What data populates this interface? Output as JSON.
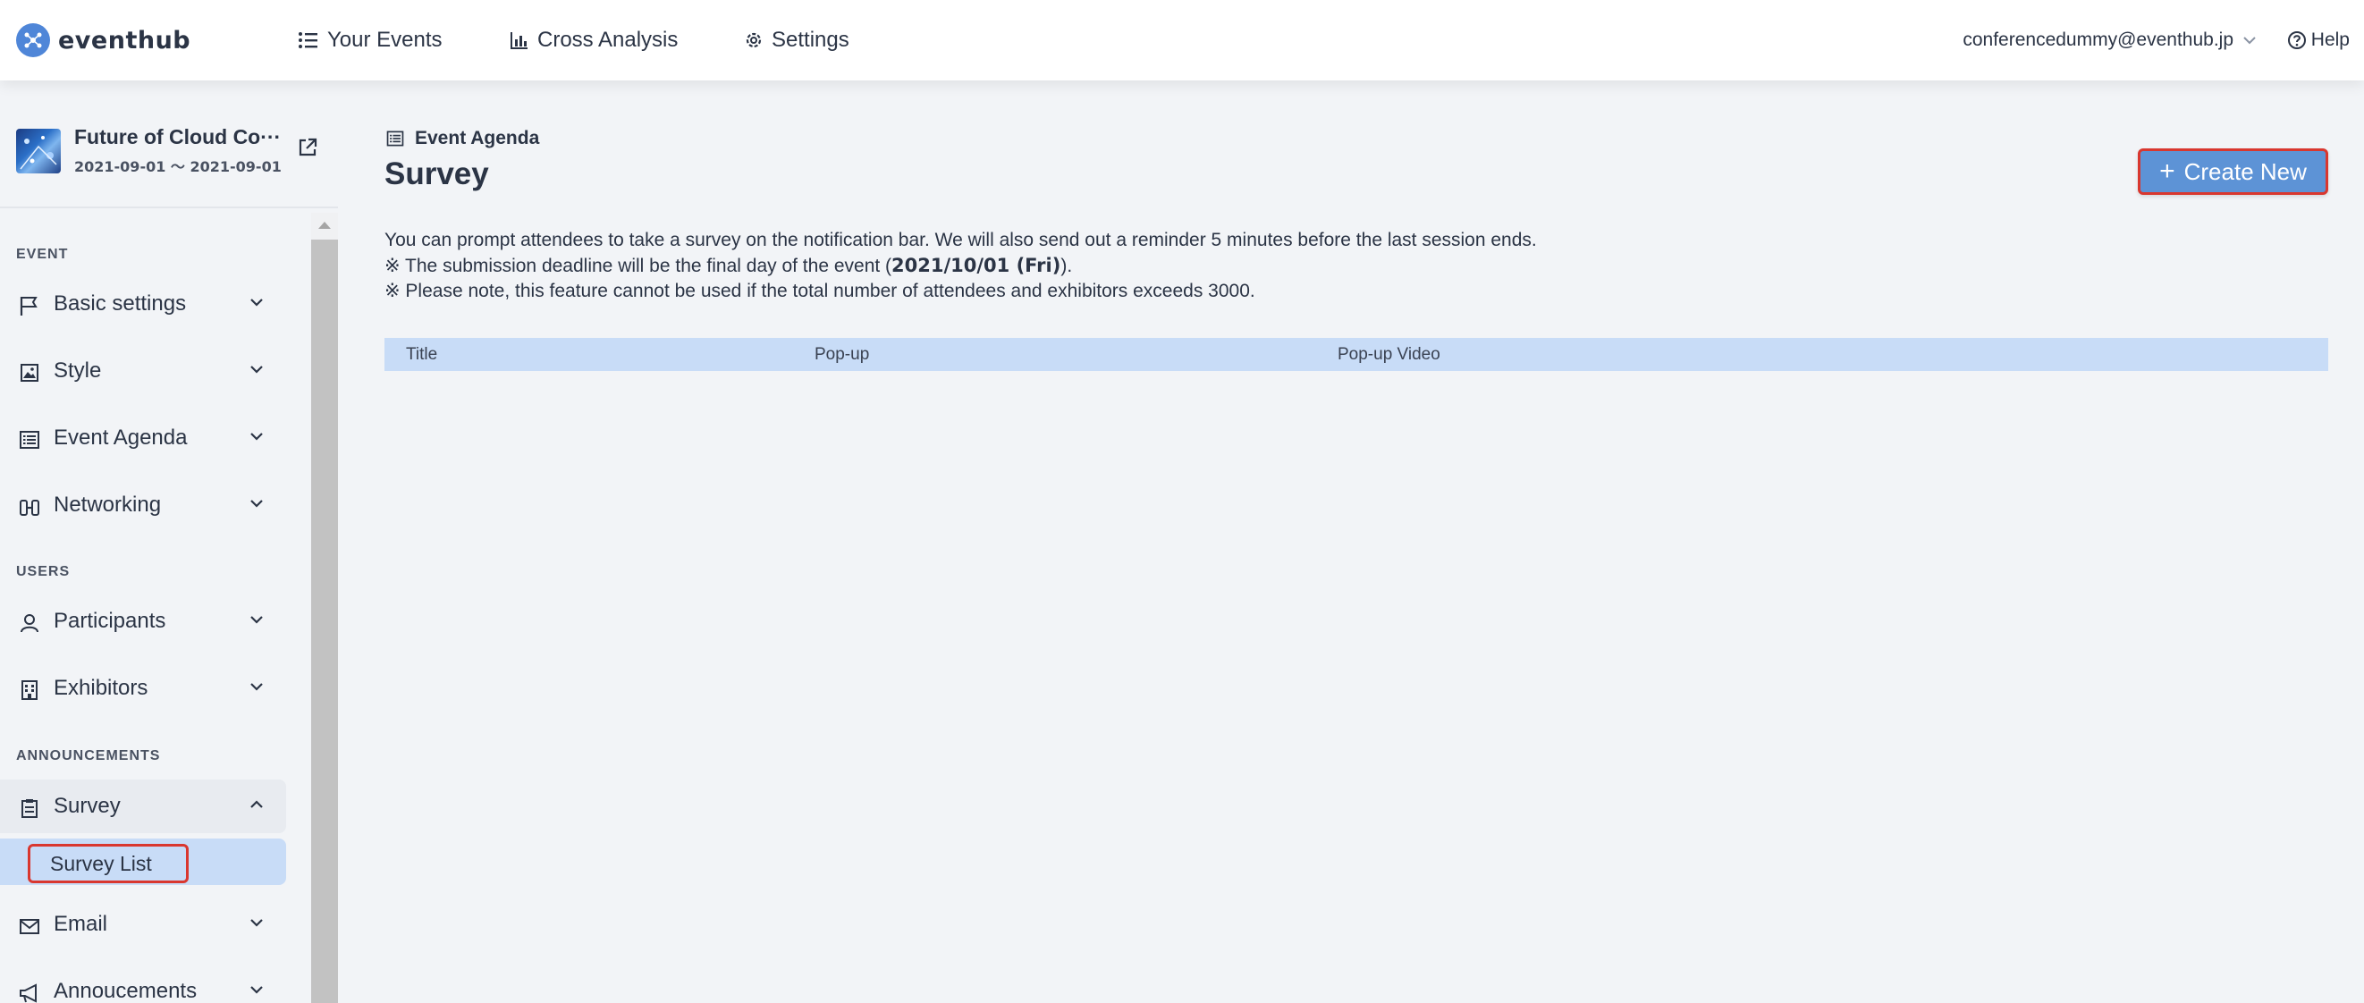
{
  "app": {
    "brand": "eventhub",
    "nav": [
      {
        "label": "Your Events",
        "icon": "list-icon"
      },
      {
        "label": "Cross Analysis",
        "icon": "bar-chart-icon"
      },
      {
        "label": "Settings",
        "icon": "gear-icon"
      }
    ],
    "account_email": "conferencedummy@eventhub.jp",
    "help_label": "Help",
    "accent_color": "#5d93d6",
    "highlight_color": "#d9372f"
  },
  "sidebar": {
    "event_title": "Future of Cloud Co···",
    "event_dates": "2021-09-01 〜 2021-09-01",
    "sections": {
      "event": "EVENT",
      "users": "USERS",
      "announcements": "ANNOUNCEMENTS"
    },
    "items": {
      "basic_settings": "Basic settings",
      "style": "Style",
      "event_agenda": "Event Agenda",
      "networking": "Networking",
      "participants": "Participants",
      "exhibitors": "Exhibitors",
      "survey": "Survey",
      "survey_list": "Survey List",
      "email": "Email",
      "announcements": "Annoucements"
    }
  },
  "main": {
    "breadcrumb": "Event Agenda",
    "title": "Survey",
    "create_button": "Create New",
    "description": {
      "line1": "You can prompt attendees to take a survey on the notification bar. We will also send out a reminder 5 minutes before the last session ends.",
      "line2_prefix": "※ The submission deadline will be the final day of the event (",
      "line2_date": "2021/10/01 (Fri)",
      "line2_suffix": ").",
      "line3": "※ Please note, this feature cannot be used if the total number of attendees and exhibitors exceeds 3000."
    },
    "table": {
      "columns": [
        "Title",
        "Pop-up",
        "Pop-up Video"
      ]
    }
  }
}
